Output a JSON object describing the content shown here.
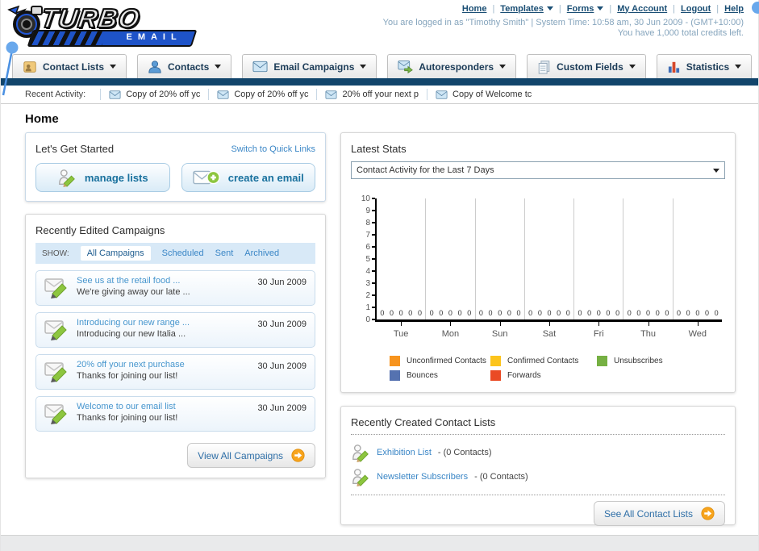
{
  "header": {
    "logo": {
      "title": "TURBO",
      "subtitle": "EMAIL"
    },
    "nav_links": [
      {
        "label": "Home",
        "dropdown": false
      },
      {
        "label": "Templates",
        "dropdown": true
      },
      {
        "label": "Forms",
        "dropdown": true
      },
      {
        "label": "My Account",
        "dropdown": false
      },
      {
        "label": "Logout",
        "dropdown": false
      },
      {
        "label": "Help",
        "dropdown": false
      }
    ],
    "status_line1": "You are logged in as \"Timothy Smith\" | System Time: 10:58 am, 30 Jun 2009 - (GMT+10:00)",
    "status_line2": "You have 1,000 total credits left."
  },
  "main_nav": {
    "tabs": [
      {
        "label": "Contact Lists"
      },
      {
        "label": "Contacts"
      },
      {
        "label": "Email Campaigns"
      },
      {
        "label": "Autoresponders"
      },
      {
        "label": "Custom Fields"
      },
      {
        "label": "Statistics"
      }
    ]
  },
  "recent_activity": {
    "label": "Recent Activity:",
    "items": [
      "Copy of 20% off yc",
      "Copy of 20% off yc",
      "20% off your next p",
      "Copy of Welcome tc"
    ]
  },
  "page_title": "Home",
  "get_started": {
    "title": "Let's Get Started",
    "switch_link": "Switch to Quick Links",
    "manage_lists_label": "manage lists",
    "create_email_label": "create an email"
  },
  "campaigns": {
    "title": "Recently Edited Campaigns",
    "show_label": "SHOW:",
    "tabs": [
      "All Campaigns",
      "Scheduled",
      "Sent",
      "Archived"
    ],
    "active_tab": "All Campaigns",
    "items": [
      {
        "title": "See us at the retail food ...",
        "subtitle": "We're giving away our late ...",
        "date": "30 Jun 2009"
      },
      {
        "title": "Introducing our new range ...",
        "subtitle": "Introducing our new Italia ...",
        "date": "30 Jun 2009"
      },
      {
        "title": "20% off your next purchase",
        "subtitle": "Thanks for joining our list!",
        "date": "30 Jun 2009"
      },
      {
        "title": "Welcome to our email list",
        "subtitle": "Thanks for joining our list!",
        "date": "30 Jun 2009"
      }
    ],
    "view_all_label": "View All Campaigns"
  },
  "stats": {
    "title": "Latest Stats",
    "filter_value": "Contact Activity for the Last 7 Days"
  },
  "chart_data": {
    "type": "bar",
    "title": "Contact Activity for the Last 7 Days",
    "categories": [
      "Tue",
      "Mon",
      "Sun",
      "Sat",
      "Fri",
      "Thu",
      "Wed"
    ],
    "series": [
      {
        "name": "Unconfirmed Contacts",
        "color": "#f7941e",
        "values": [
          0,
          0,
          0,
          0,
          0,
          0,
          0
        ]
      },
      {
        "name": "Confirmed Contacts",
        "color": "#fcc41c",
        "values": [
          0,
          0,
          0,
          0,
          0,
          0,
          0
        ]
      },
      {
        "name": "Unsubscribes",
        "color": "#76b043",
        "values": [
          0,
          0,
          0,
          0,
          0,
          0,
          0
        ]
      },
      {
        "name": "Bounces",
        "color": "#5572b0",
        "values": [
          0,
          0,
          0,
          0,
          0,
          0,
          0
        ]
      },
      {
        "name": "Forwards",
        "color": "#ea4a24",
        "values": [
          0,
          0,
          0,
          0,
          0,
          0,
          0
        ]
      }
    ],
    "ylim": [
      0,
      10
    ],
    "yticks": [
      0,
      1,
      2,
      3,
      4,
      5,
      6,
      7,
      8,
      9,
      10
    ],
    "grid": "vertical-only",
    "legend_position": "bottom"
  },
  "contact_lists": {
    "title": "Recently Created Contact Lists",
    "items": [
      {
        "name": "Exhibition List",
        "suffix": "- (0 Contacts)"
      },
      {
        "name": "Newsletter Subscribers",
        "suffix": "- (0 Contacts)"
      }
    ],
    "see_all_label": "See All Contact Lists"
  },
  "colors": {
    "nav_bar": "#12456b",
    "link_blue": "#3a86c6",
    "accent_orange": "#f7a41d"
  }
}
